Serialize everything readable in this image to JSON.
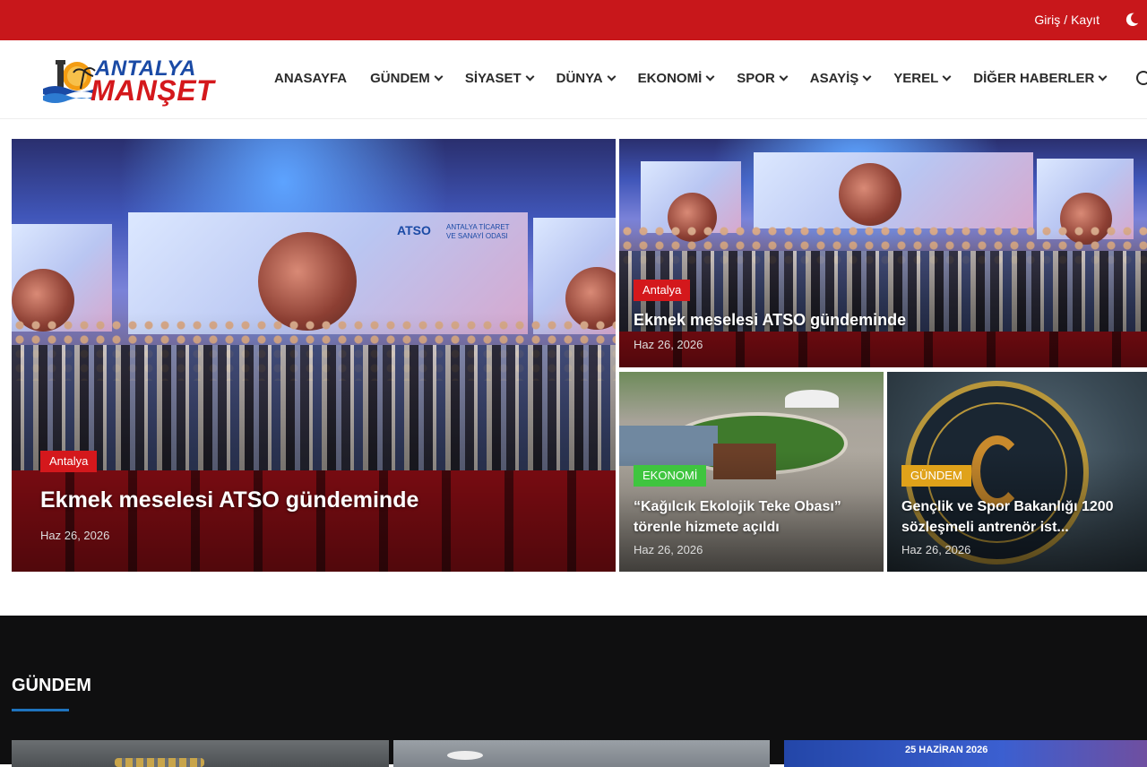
{
  "topbar": {
    "login": "Giriş",
    "separator": "/",
    "register": "Kayıt",
    "theme_icon": "moon-icon"
  },
  "header": {
    "logo": {
      "line1": "ANTALYA",
      "line2": "MANŞET"
    },
    "nav": [
      {
        "label": "ANASAYFA",
        "dropdown": false
      },
      {
        "label": "GÜNDEM",
        "dropdown": true
      },
      {
        "label": "SİYASET",
        "dropdown": true
      },
      {
        "label": "DÜNYA",
        "dropdown": true
      },
      {
        "label": "EKONOMİ",
        "dropdown": true
      },
      {
        "label": "SPOR",
        "dropdown": true
      },
      {
        "label": "ASAYİŞ",
        "dropdown": true
      },
      {
        "label": "YEREL",
        "dropdown": true
      },
      {
        "label": "DİĞER HABERLER",
        "dropdown": true
      }
    ],
    "search_icon": "search-icon"
  },
  "hero": {
    "main": {
      "category": "Antalya",
      "title": "Ekmek meselesi ATSO gündeminde",
      "date": "Haz 26, 2026",
      "badge_color": "#d4181c"
    },
    "top_right": {
      "category": "Antalya",
      "title": "Ekmek meselesi ATSO gündeminde",
      "date": "Haz 26, 2026",
      "badge_color": "#d4181c"
    },
    "bottom_left": {
      "category": "EKONOMİ",
      "title": "“Kağılcık Ekolojik Teke Obası” törenle hizmete açıldı",
      "date": "Haz 26, 2026",
      "badge_color": "#3fc53f"
    },
    "bottom_right": {
      "category": "GÜNDEM",
      "title": "Gençlik ve Spor Bakanlığı 1200 sözleşmeli antrenör ist...",
      "date": "Haz 26, 2026",
      "badge_color": "#e0a21a"
    },
    "screen_text": {
      "brand": "ATSO",
      "org_line1": "ANTALYA TİCARET",
      "org_line2": "VE SANAYİ ODASI"
    }
  },
  "gundem": {
    "title": "GÜNDEM",
    "accent": "#1e73be",
    "thumb3_text": "25 HAZİRAN 2026"
  },
  "colors": {
    "topbar": "#c8171b",
    "dark_section": "#0f0f10"
  }
}
